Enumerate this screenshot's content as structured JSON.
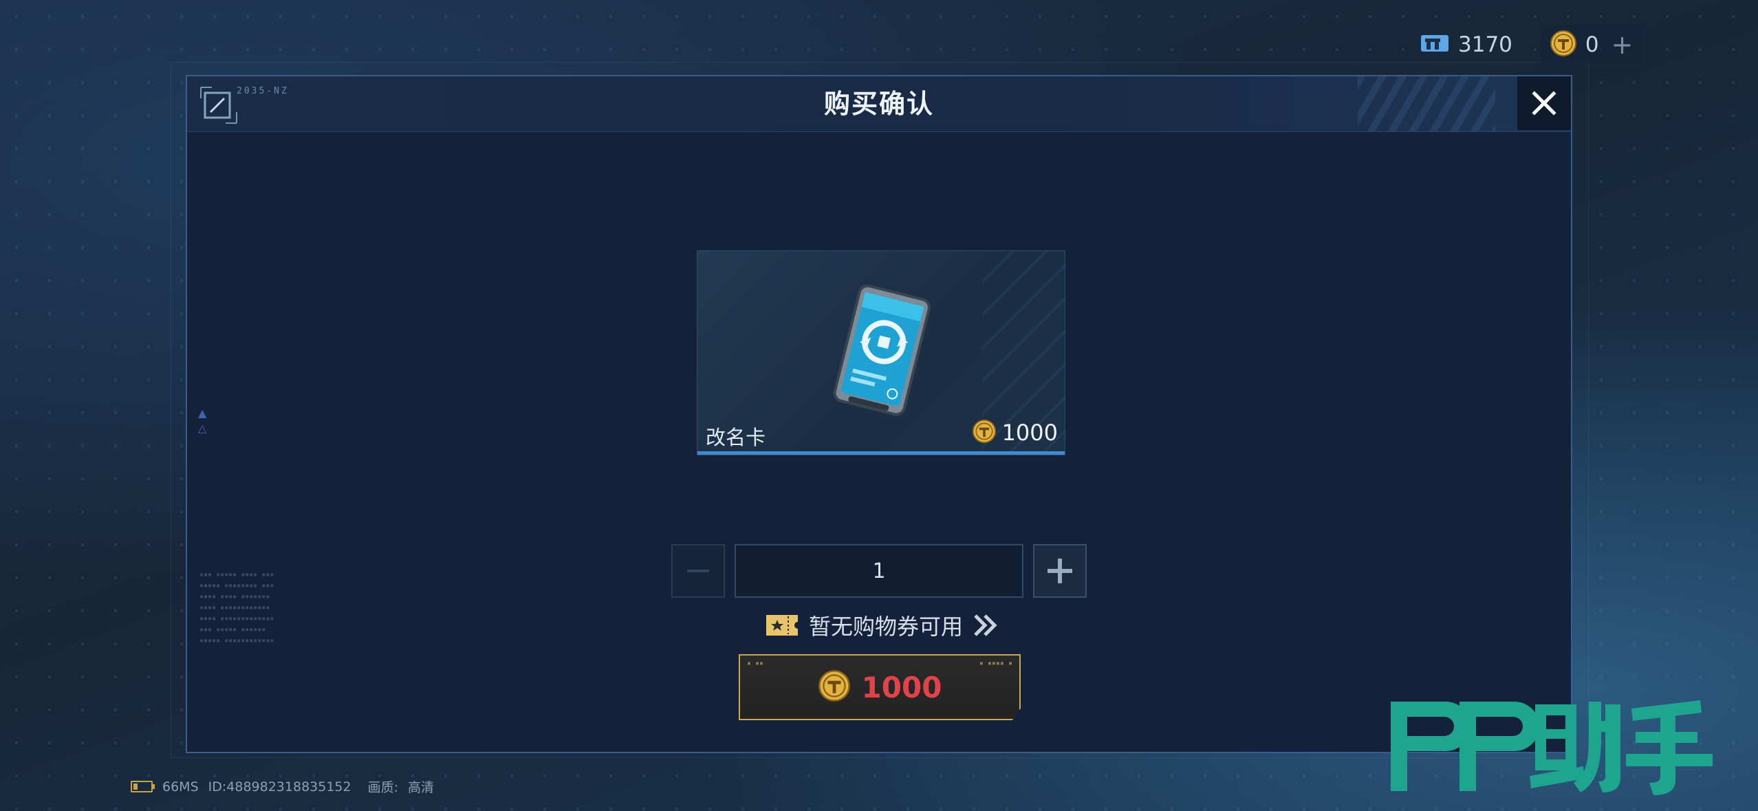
{
  "currency": {
    "tickets": {
      "icon": "ticket-currency-icon",
      "value": "3170"
    },
    "coins": {
      "icon": "gold-coin-icon",
      "value": "0",
      "add_icon": "plus-icon"
    }
  },
  "dialog": {
    "title": "购买确认",
    "deco_code": "2035-NZ",
    "close_icon": "close-icon"
  },
  "item": {
    "name": "改名卡",
    "price": "1000",
    "price_icon": "gold-coin-icon"
  },
  "quantity": {
    "value": "1",
    "minus_icon": "minus-icon",
    "plus_icon": "plus-icon"
  },
  "coupon": {
    "text": "暂无购物券可用",
    "icon": "coupon-ticket-icon",
    "arrow_icon": "double-chevron-right-icon"
  },
  "buy": {
    "price": "1000",
    "icon": "gold-coin-icon"
  },
  "status": {
    "latency": "66MS",
    "id": "ID:488982318835152",
    "quality_label": "画质:",
    "quality_value": "高清"
  },
  "watermark": {
    "text": "PP助手"
  },
  "colors": {
    "accent_blue": "#3f8ad0",
    "price_red": "#e0434a",
    "gold": "#c9a658",
    "watermark_green": "#1fa58f"
  }
}
